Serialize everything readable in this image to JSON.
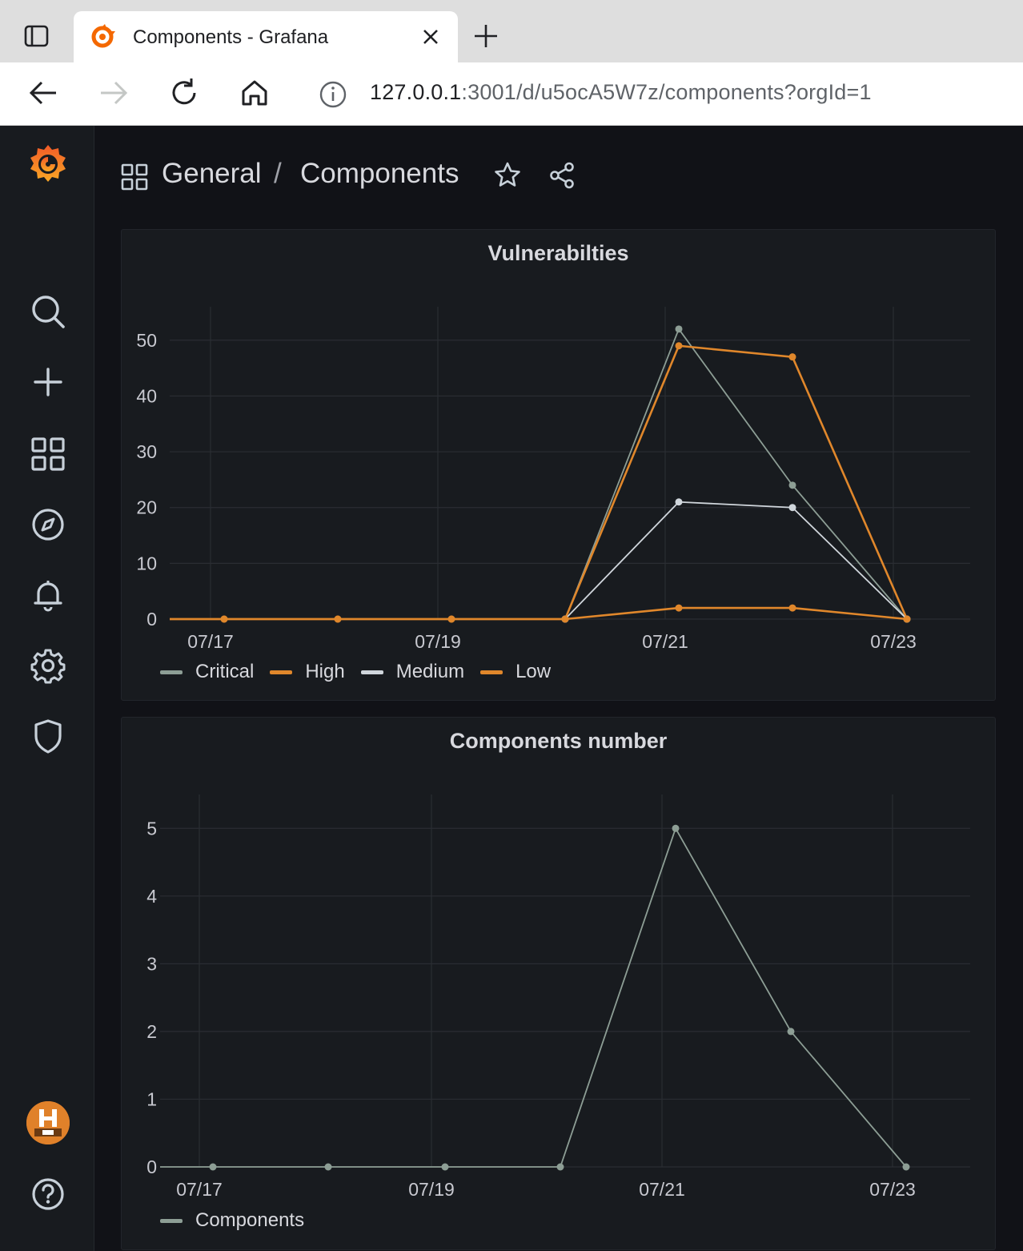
{
  "browser": {
    "tab_title": "Components - Grafana",
    "url_host": "127.0.0.1",
    "url_rest": ":3001/d/u5ocA5W7z/components?orgId=1"
  },
  "breadcrumb": {
    "folder": "General",
    "separator": "/",
    "dashboard": "Components"
  },
  "sidebar": {
    "items": [
      "search-icon",
      "plus-icon",
      "dashboards-icon",
      "explore-icon",
      "alerting-icon",
      "settings-icon",
      "shield-icon"
    ],
    "bottom": [
      "avatar",
      "help-icon"
    ]
  },
  "colors": {
    "critical": "#8d9e95",
    "high": "#e0872b",
    "medium": "#d0d6dc",
    "low": "#e0872b",
    "components": "#8d9e95",
    "grafana_orange": "#f46800"
  },
  "panels": {
    "vuln_title": "Vulnerabilties",
    "comp_title": "Components number"
  },
  "chart_data": [
    {
      "type": "line",
      "title": "Vulnerabilties",
      "x": [
        "07/16 12:00",
        "07/17",
        "07/18",
        "07/19",
        "07/20",
        "07/21",
        "07/22",
        "07/23"
      ],
      "x_tick_labels": [
        "07/17",
        "07/19",
        "07/21",
        "07/23"
      ],
      "y_tick_labels": [
        "0",
        "10",
        "20",
        "30",
        "40",
        "50"
      ],
      "ylim": [
        0,
        56
      ],
      "grid": true,
      "legend_position": "bottom-left",
      "series": [
        {
          "name": "Critical",
          "color_key": "critical",
          "values": [
            null,
            null,
            null,
            null,
            0,
            52,
            24,
            0
          ]
        },
        {
          "name": "High",
          "color_key": "high",
          "values": [
            null,
            0,
            0,
            0,
            0,
            49,
            47,
            0
          ]
        },
        {
          "name": "Medium",
          "color_key": "medium",
          "values": [
            null,
            null,
            null,
            null,
            0,
            21,
            20,
            0
          ]
        },
        {
          "name": "Low",
          "color_key": "low",
          "values": [
            null,
            0,
            0,
            0,
            0,
            2,
            2,
            0
          ]
        }
      ]
    },
    {
      "type": "line",
      "title": "Components number",
      "x": [
        "07/16 12:00",
        "07/17",
        "07/18",
        "07/19",
        "07/20",
        "07/21",
        "07/22",
        "07/23"
      ],
      "x_tick_labels": [
        "07/17",
        "07/19",
        "07/21",
        "07/23"
      ],
      "y_tick_labels": [
        "0",
        "1",
        "2",
        "3",
        "4",
        "5"
      ],
      "ylim": [
        0,
        5.5
      ],
      "grid": true,
      "legend_position": "bottom-left",
      "series": [
        {
          "name": "Components",
          "color_key": "components",
          "values": [
            null,
            0,
            0,
            0,
            0,
            5,
            2,
            0
          ]
        }
      ]
    }
  ]
}
